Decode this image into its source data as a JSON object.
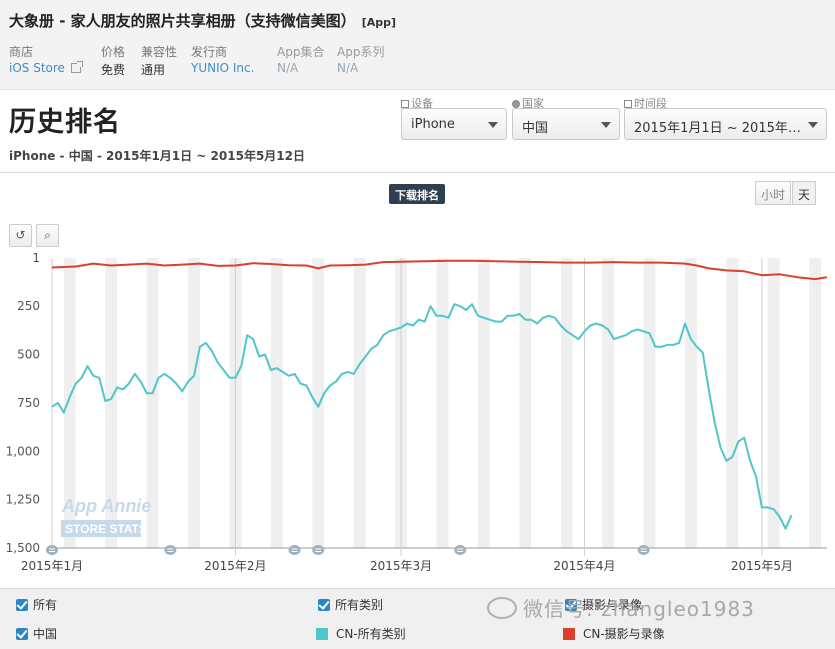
{
  "app": {
    "title": "大象册 - 家人朋友的照片共享相册（支持微信美图）",
    "tag": "[App]"
  },
  "meta": [
    {
      "key": "商店",
      "value": "iOS Store",
      "link": true,
      "external_icon": "external-link-icon"
    },
    {
      "key": "价格",
      "value": "免费"
    },
    {
      "key": "兼容性",
      "value": "通用"
    },
    {
      "key": "发行商",
      "value": "YUNIO Inc.",
      "link": true
    },
    {
      "key": "App集合",
      "value": "N/A",
      "muted": true
    },
    {
      "key": "App系列",
      "value": "N/A",
      "muted": true
    }
  ],
  "page": {
    "title": "历史排名",
    "subtitle": "iPhone - 中国 - 2015年1月1日 ~ 2015年5月12日"
  },
  "filters": {
    "device": {
      "label": "设备",
      "value": "iPhone",
      "icon": "device-icon"
    },
    "country": {
      "label": "国家",
      "value": "中国",
      "icon": "globe-icon"
    },
    "period": {
      "label": "时间段",
      "value": "2015年1月1日 ~ 2015年5月12日",
      "icon": "calendar-icon"
    }
  },
  "chart_toolbar": {
    "badge": "下载排名",
    "toggle_hour": "小时",
    "toggle_day": "天",
    "reset_icon": "reset-icon",
    "zoom_icon": "zoom-icon"
  },
  "watermark": {
    "brand": "App Annie",
    "sub": "STORE STATS",
    "social": "微信号: zhangleo1983"
  },
  "legend": {
    "checks": [
      {
        "label": "所有"
      },
      {
        "label": "所有类别"
      },
      {
        "label": "摄影与录像"
      },
      {
        "label": "中国"
      }
    ],
    "series": [
      {
        "label": "CN-所有类别",
        "color": "#4fc6c9"
      },
      {
        "label": "CN-摄影与录像",
        "color": "#d9402b"
      }
    ]
  },
  "chart_data": {
    "type": "line",
    "title": "",
    "xlabel": "",
    "ylabel": "",
    "y_inverted": true,
    "ylim": [
      1,
      1500
    ],
    "yticks": [
      1,
      250,
      500,
      750,
      1000,
      1250,
      1500
    ],
    "ytick_labels": [
      "1",
      "250",
      "500",
      "750",
      "1,000",
      "1,250",
      "1,500"
    ],
    "x_range": [
      "2015-01-01",
      "2015-05-12"
    ],
    "xticks": [
      {
        "date": "2015-01-01",
        "label": "2015年1月"
      },
      {
        "date": "2015-02-01",
        "label": "2015年2月"
      },
      {
        "date": "2015-03-01",
        "label": "2015年3月"
      },
      {
        "date": "2015-04-01",
        "label": "2015年4月"
      },
      {
        "date": "2015-05-01",
        "label": "2015年5月"
      }
    ],
    "grid": "alternating weekend shading",
    "annotations_dates": [
      "2015-01-01",
      "2015-01-21",
      "2015-02-11",
      "2015-02-15",
      "2015-03-11",
      "2015-04-11"
    ],
    "series": [
      {
        "name": "CN-所有类别",
        "color": "#4fc6c9",
        "points": [
          [
            "2015-01-01",
            770
          ],
          [
            "2015-01-02",
            750
          ],
          [
            "2015-01-03",
            800
          ],
          [
            "2015-01-04",
            720
          ],
          [
            "2015-01-05",
            650
          ],
          [
            "2015-01-06",
            620
          ],
          [
            "2015-01-07",
            560
          ],
          [
            "2015-01-08",
            610
          ],
          [
            "2015-01-09",
            620
          ],
          [
            "2015-01-10",
            740
          ],
          [
            "2015-01-11",
            730
          ],
          [
            "2015-01-12",
            670
          ],
          [
            "2015-01-13",
            680
          ],
          [
            "2015-01-14",
            650
          ],
          [
            "2015-01-15",
            600
          ],
          [
            "2015-01-16",
            640
          ],
          [
            "2015-01-17",
            700
          ],
          [
            "2015-01-18",
            700
          ],
          [
            "2015-01-19",
            620
          ],
          [
            "2015-01-20",
            600
          ],
          [
            "2015-01-21",
            620
          ],
          [
            "2015-01-22",
            650
          ],
          [
            "2015-01-23",
            690
          ],
          [
            "2015-01-24",
            640
          ],
          [
            "2015-01-25",
            610
          ],
          [
            "2015-01-26",
            460
          ],
          [
            "2015-01-27",
            440
          ],
          [
            "2015-01-28",
            480
          ],
          [
            "2015-01-29",
            540
          ],
          [
            "2015-01-30",
            580
          ],
          [
            "2015-01-31",
            620
          ],
          [
            "2015-02-01",
            620
          ],
          [
            "2015-02-02",
            560
          ],
          [
            "2015-02-03",
            400
          ],
          [
            "2015-02-04",
            420
          ],
          [
            "2015-02-05",
            510
          ],
          [
            "2015-02-06",
            500
          ],
          [
            "2015-02-07",
            580
          ],
          [
            "2015-02-08",
            570
          ],
          [
            "2015-02-09",
            590
          ],
          [
            "2015-02-10",
            610
          ],
          [
            "2015-02-11",
            600
          ],
          [
            "2015-02-12",
            650
          ],
          [
            "2015-02-13",
            660
          ],
          [
            "2015-02-14",
            720
          ],
          [
            "2015-02-15",
            770
          ],
          [
            "2015-02-16",
            700
          ],
          [
            "2015-02-17",
            660
          ],
          [
            "2015-02-18",
            640
          ],
          [
            "2015-02-19",
            600
          ],
          [
            "2015-02-20",
            590
          ],
          [
            "2015-02-21",
            600
          ],
          [
            "2015-02-22",
            550
          ],
          [
            "2015-02-23",
            510
          ],
          [
            "2015-02-24",
            470
          ],
          [
            "2015-02-25",
            450
          ],
          [
            "2015-02-26",
            400
          ],
          [
            "2015-02-27",
            380
          ],
          [
            "2015-02-28",
            370
          ],
          [
            "2015-03-01",
            360
          ],
          [
            "2015-03-02",
            340
          ],
          [
            "2015-03-03",
            350
          ],
          [
            "2015-03-04",
            320
          ],
          [
            "2015-03-05",
            330
          ],
          [
            "2015-03-06",
            250
          ],
          [
            "2015-03-07",
            300
          ],
          [
            "2015-03-08",
            300
          ],
          [
            "2015-03-09",
            310
          ],
          [
            "2015-03-10",
            240
          ],
          [
            "2015-03-11",
            250
          ],
          [
            "2015-03-12",
            270
          ],
          [
            "2015-03-13",
            240
          ],
          [
            "2015-03-14",
            300
          ],
          [
            "2015-03-15",
            310
          ],
          [
            "2015-03-16",
            320
          ],
          [
            "2015-03-17",
            330
          ],
          [
            "2015-03-18",
            330
          ],
          [
            "2015-03-19",
            300
          ],
          [
            "2015-03-20",
            300
          ],
          [
            "2015-03-21",
            290
          ],
          [
            "2015-03-22",
            320
          ],
          [
            "2015-03-23",
            320
          ],
          [
            "2015-03-24",
            340
          ],
          [
            "2015-03-25",
            310
          ],
          [
            "2015-03-26",
            300
          ],
          [
            "2015-03-27",
            310
          ],
          [
            "2015-03-28",
            350
          ],
          [
            "2015-03-29",
            380
          ],
          [
            "2015-03-30",
            400
          ],
          [
            "2015-03-31",
            420
          ],
          [
            "2015-04-01",
            380
          ],
          [
            "2015-04-02",
            350
          ],
          [
            "2015-04-03",
            340
          ],
          [
            "2015-04-04",
            350
          ],
          [
            "2015-04-05",
            370
          ],
          [
            "2015-04-06",
            420
          ],
          [
            "2015-04-07",
            410
          ],
          [
            "2015-04-08",
            400
          ],
          [
            "2015-04-09",
            380
          ],
          [
            "2015-04-10",
            370
          ],
          [
            "2015-04-11",
            380
          ],
          [
            "2015-04-12",
            390
          ],
          [
            "2015-04-13",
            460
          ],
          [
            "2015-04-14",
            460
          ],
          [
            "2015-04-15",
            450
          ],
          [
            "2015-04-16",
            450
          ],
          [
            "2015-04-17",
            440
          ],
          [
            "2015-04-18",
            340
          ],
          [
            "2015-04-19",
            420
          ],
          [
            "2015-04-20",
            460
          ],
          [
            "2015-04-21",
            490
          ],
          [
            "2015-04-22",
            680
          ],
          [
            "2015-04-23",
            850
          ],
          [
            "2015-04-24",
            980
          ],
          [
            "2015-04-25",
            1050
          ],
          [
            "2015-04-26",
            1030
          ],
          [
            "2015-04-27",
            950
          ],
          [
            "2015-04-28",
            930
          ],
          [
            "2015-04-29",
            1050
          ],
          [
            "2015-04-30",
            1130
          ],
          [
            "2015-05-01",
            1290
          ],
          [
            "2015-05-02",
            1290
          ],
          [
            "2015-05-03",
            1300
          ],
          [
            "2015-05-04",
            1340
          ],
          [
            "2015-05-05",
            1400
          ],
          [
            "2015-05-06",
            1330
          ]
        ]
      },
      {
        "name": "CN-摄影与录像",
        "color": "#d9402b",
        "points": [
          [
            "2015-01-01",
            50
          ],
          [
            "2015-01-05",
            45
          ],
          [
            "2015-01-08",
            30
          ],
          [
            "2015-01-11",
            40
          ],
          [
            "2015-01-14",
            35
          ],
          [
            "2015-01-17",
            30
          ],
          [
            "2015-01-20",
            40
          ],
          [
            "2015-01-23",
            35
          ],
          [
            "2015-01-26",
            30
          ],
          [
            "2015-01-29",
            42
          ],
          [
            "2015-02-01",
            40
          ],
          [
            "2015-02-04",
            28
          ],
          [
            "2015-02-07",
            32
          ],
          [
            "2015-02-10",
            38
          ],
          [
            "2015-02-13",
            40
          ],
          [
            "2015-02-15",
            55
          ],
          [
            "2015-02-17",
            40
          ],
          [
            "2015-02-20",
            38
          ],
          [
            "2015-02-23",
            35
          ],
          [
            "2015-02-26",
            22
          ],
          [
            "2015-03-01",
            20
          ],
          [
            "2015-03-05",
            18
          ],
          [
            "2015-03-09",
            15
          ],
          [
            "2015-03-13",
            15
          ],
          [
            "2015-03-17",
            18
          ],
          [
            "2015-03-21",
            20
          ],
          [
            "2015-03-25",
            22
          ],
          [
            "2015-03-29",
            25
          ],
          [
            "2015-04-02",
            25
          ],
          [
            "2015-04-06",
            22
          ],
          [
            "2015-04-10",
            25
          ],
          [
            "2015-04-14",
            25
          ],
          [
            "2015-04-18",
            30
          ],
          [
            "2015-04-20",
            40
          ],
          [
            "2015-04-22",
            55
          ],
          [
            "2015-04-25",
            65
          ],
          [
            "2015-04-28",
            70
          ],
          [
            "2015-05-01",
            90
          ],
          [
            "2015-05-04",
            85
          ],
          [
            "2015-05-07",
            100
          ],
          [
            "2015-05-10",
            110
          ],
          [
            "2015-05-12",
            100
          ]
        ]
      }
    ]
  }
}
